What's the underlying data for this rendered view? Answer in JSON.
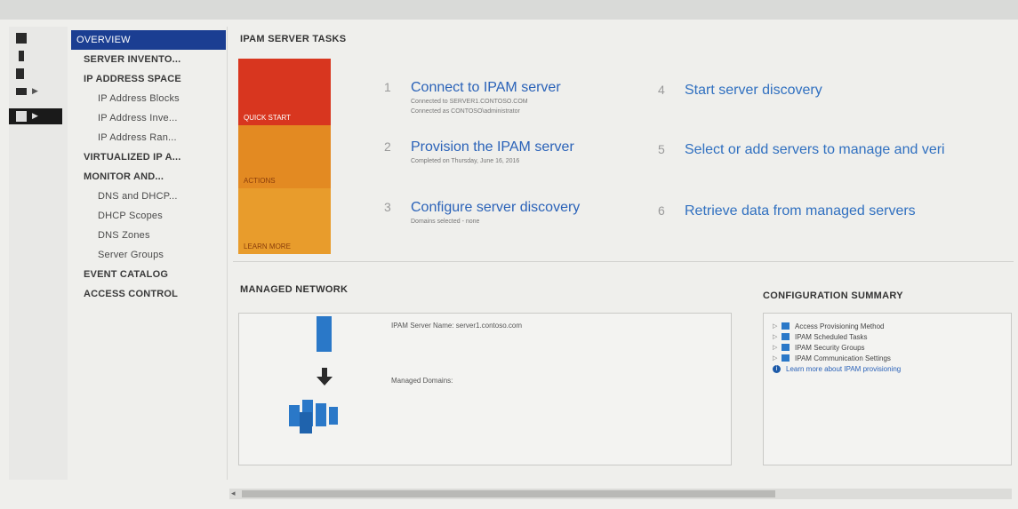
{
  "sidebar": {
    "items": [
      {
        "label": "OVERVIEW"
      },
      {
        "label": "SERVER INVENTO..."
      },
      {
        "label": "IP ADDRESS SPACE"
      },
      {
        "label": "IP Address Blocks"
      },
      {
        "label": "IP Address Inve..."
      },
      {
        "label": "IP Address Ran..."
      },
      {
        "label": "VIRTUALIZED IP A..."
      },
      {
        "label": "MONITOR AND..."
      },
      {
        "label": "DNS and DHCP..."
      },
      {
        "label": "DHCP Scopes"
      },
      {
        "label": "DNS Zones"
      },
      {
        "label": "Server Groups"
      },
      {
        "label": "EVENT CATALOG"
      },
      {
        "label": "ACCESS CONTROL"
      }
    ]
  },
  "tasks_section": {
    "title": "IPAM SERVER TASKS",
    "tiles": {
      "quick_start": "QUICK START",
      "actions": "ACTIONS",
      "learn_more": "LEARN MORE"
    },
    "tasks": [
      {
        "num": "1",
        "title": "Connect to IPAM server",
        "sub1": "Connected to SERVER1.CONTOSO.COM",
        "sub2": "Connected as CONTOSO\\administrator"
      },
      {
        "num": "2",
        "title": "Provision the IPAM server",
        "sub1": "Completed on Thursday, June 16, 2016"
      },
      {
        "num": "3",
        "title": "Configure server discovery",
        "sub1": "Domains selected - none"
      },
      {
        "num": "4",
        "title": "Start server discovery"
      },
      {
        "num": "5",
        "title": "Select or add servers to manage and veri"
      },
      {
        "num": "6",
        "title": "Retrieve data from managed servers"
      }
    ]
  },
  "managed_network": {
    "title": "MANAGED NETWORK",
    "server_name": "IPAM Server Name: server1.contoso.com",
    "domains": "Managed Domains:"
  },
  "config_summary": {
    "title": "CONFIGURATION SUMMARY",
    "items": [
      {
        "label": "Access Provisioning Method"
      },
      {
        "label": "IPAM Scheduled Tasks"
      },
      {
        "label": "IPAM Security Groups"
      },
      {
        "label": "IPAM Communication Settings"
      }
    ],
    "learn_link": "Learn more about IPAM provisioning"
  },
  "colors": {
    "accent": "#1b3e92",
    "quick_start": "#d8361f",
    "actions": "#e38a22",
    "learn_more": "#e89c2c",
    "link": "#2a62b8"
  },
  "icons": [
    "dashboard-icon",
    "server-icon",
    "servers-icon",
    "network-icon",
    "ipam-icon",
    "arrow-down-icon",
    "info-icon"
  ]
}
